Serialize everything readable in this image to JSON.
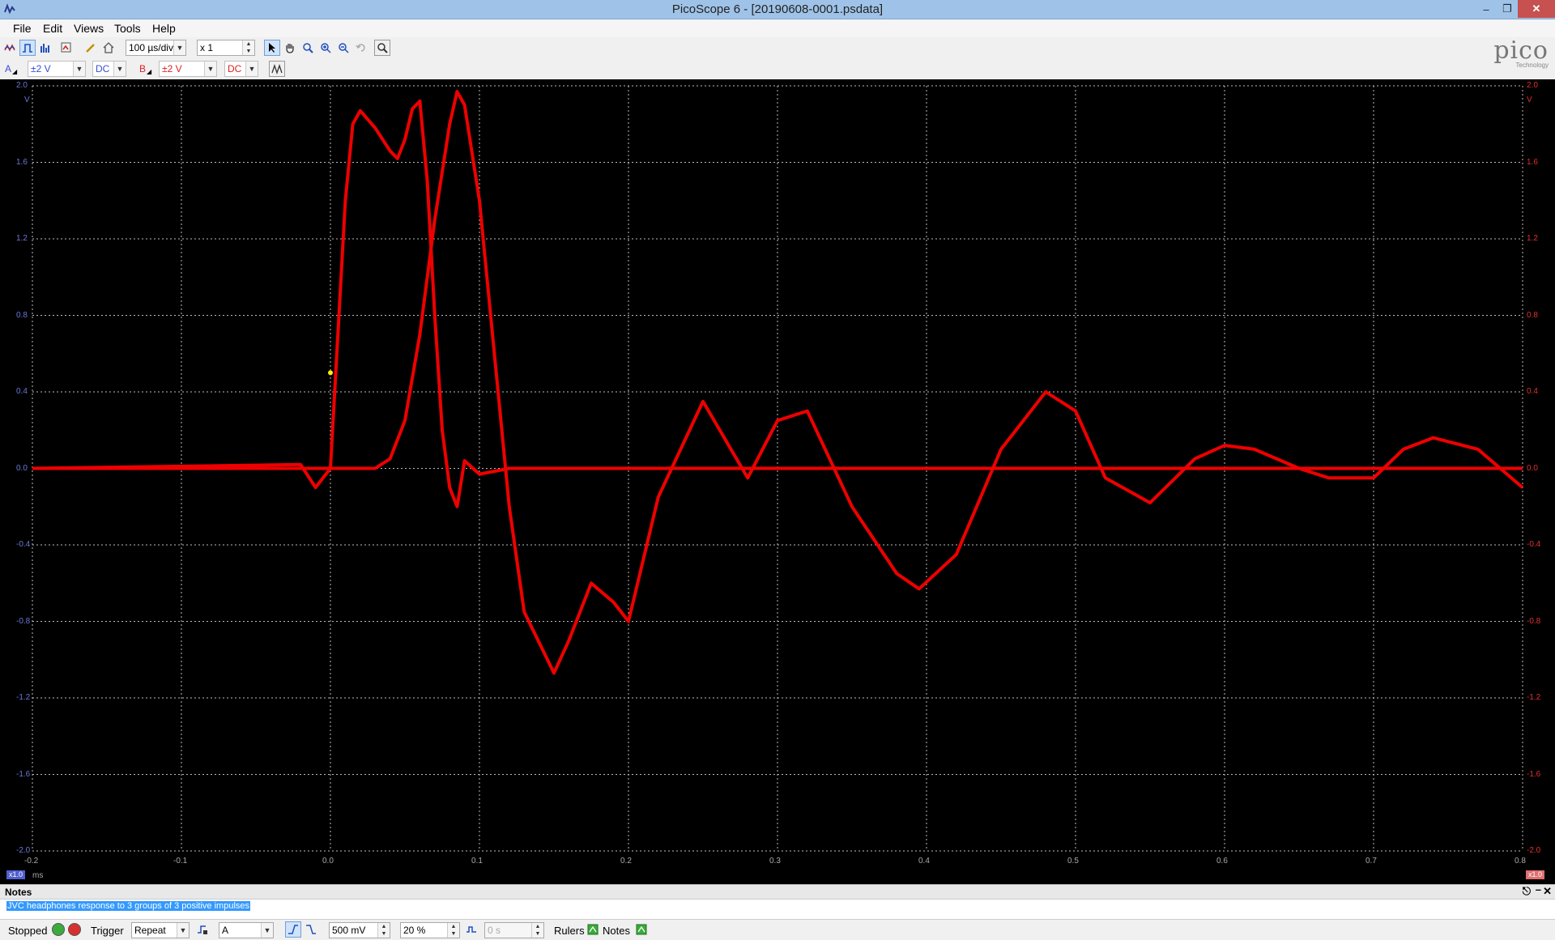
{
  "window": {
    "title": "PicoScope 6 - [20190608-0001.psdata]"
  },
  "menu": {
    "items": [
      "File",
      "Edit",
      "Views",
      "Tools",
      "Help"
    ]
  },
  "toolbar": {
    "timebase": "100 µs/div",
    "zoom": "x 1"
  },
  "channels": {
    "a": {
      "name": "A",
      "range": "±2 V",
      "coupling": "DC",
      "color": "#3a4fd0"
    },
    "b": {
      "name": "B",
      "range": "±2 V",
      "coupling": "DC",
      "color": "#e02020"
    }
  },
  "logo": {
    "main": "pico",
    "sub": "Technology"
  },
  "chart_data": {
    "type": "line",
    "x_unit": "ms",
    "xlim": [
      -0.2,
      0.8
    ],
    "x_ticks": [
      "-0.2",
      "-0.1",
      "0.0",
      "0.1",
      "0.2",
      "0.3",
      "0.4",
      "0.5",
      "0.6",
      "0.7",
      "0.8"
    ],
    "left_unit": "V",
    "right_unit": "V",
    "ylim": [
      -2.0,
      2.0
    ],
    "left_ticks": [
      "2.0",
      "1.6",
      "1.2",
      "0.8",
      "0.4",
      "0.0",
      "-0.4",
      "-0.8",
      "-1.2",
      "-1.6",
      "-2.0"
    ],
    "right_ticks": [
      "2.0",
      "1.6",
      "1.2",
      "0.8",
      "0.4",
      "0.0",
      "-0.4",
      "-0.8",
      "-1.2",
      "-1.6",
      "-2.0"
    ],
    "left_scale": "x1.0",
    "right_scale": "x1.0",
    "grid": true,
    "series": [
      {
        "color": "#ee0000",
        "x": [
          -0.2,
          -0.02,
          -0.01,
          0.0,
          0.005,
          0.01,
          0.015,
          0.02,
          0.03,
          0.04,
          0.045,
          0.05,
          0.055,
          0.06,
          0.065,
          0.07,
          0.075,
          0.08,
          0.085,
          0.09,
          0.1,
          0.12,
          0.15,
          0.2,
          0.5,
          0.8
        ],
        "y": [
          0.0,
          0.02,
          -0.1,
          0.0,
          0.7,
          1.4,
          1.8,
          1.87,
          1.78,
          1.66,
          1.62,
          1.72,
          1.88,
          1.92,
          1.5,
          0.8,
          0.2,
          -0.1,
          -0.2,
          0.04,
          -0.03,
          0.0,
          0.0,
          0.0,
          0.0,
          0.0
        ]
      },
      {
        "color": "#ee0000",
        "x": [
          -0.2,
          0.03,
          0.04,
          0.05,
          0.06,
          0.07,
          0.08,
          0.085,
          0.09,
          0.1,
          0.11,
          0.12,
          0.13,
          0.15,
          0.16,
          0.175,
          0.19,
          0.2,
          0.22,
          0.25,
          0.28,
          0.3,
          0.32,
          0.35,
          0.38,
          0.395,
          0.42,
          0.45,
          0.48,
          0.5,
          0.52,
          0.55,
          0.58,
          0.6,
          0.62,
          0.65,
          0.67,
          0.7,
          0.72,
          0.74,
          0.77,
          0.8
        ],
        "y": [
          0.0,
          0.0,
          0.05,
          0.25,
          0.7,
          1.3,
          1.8,
          1.97,
          1.9,
          1.4,
          0.6,
          -0.2,
          -0.75,
          -1.07,
          -0.9,
          -0.6,
          -0.7,
          -0.8,
          -0.15,
          0.35,
          -0.05,
          0.25,
          0.3,
          -0.2,
          -0.55,
          -0.63,
          -0.45,
          0.1,
          0.4,
          0.3,
          -0.05,
          -0.18,
          0.05,
          0.12,
          0.1,
          0.0,
          -0.05,
          -0.05,
          0.1,
          0.16,
          0.1,
          -0.1
        ]
      }
    ]
  },
  "notes": {
    "header": "Notes",
    "text": "JVC headphones response to 3 groups of 3 positive impulses"
  },
  "status": {
    "state": "Stopped",
    "trigger_label": "Trigger",
    "trigger_mode": "Repeat",
    "trigger_source": "A",
    "threshold": "500 mV",
    "pretrigger": "20 %",
    "delay": "0 s",
    "rulers": "Rulers",
    "notes": "Notes"
  }
}
